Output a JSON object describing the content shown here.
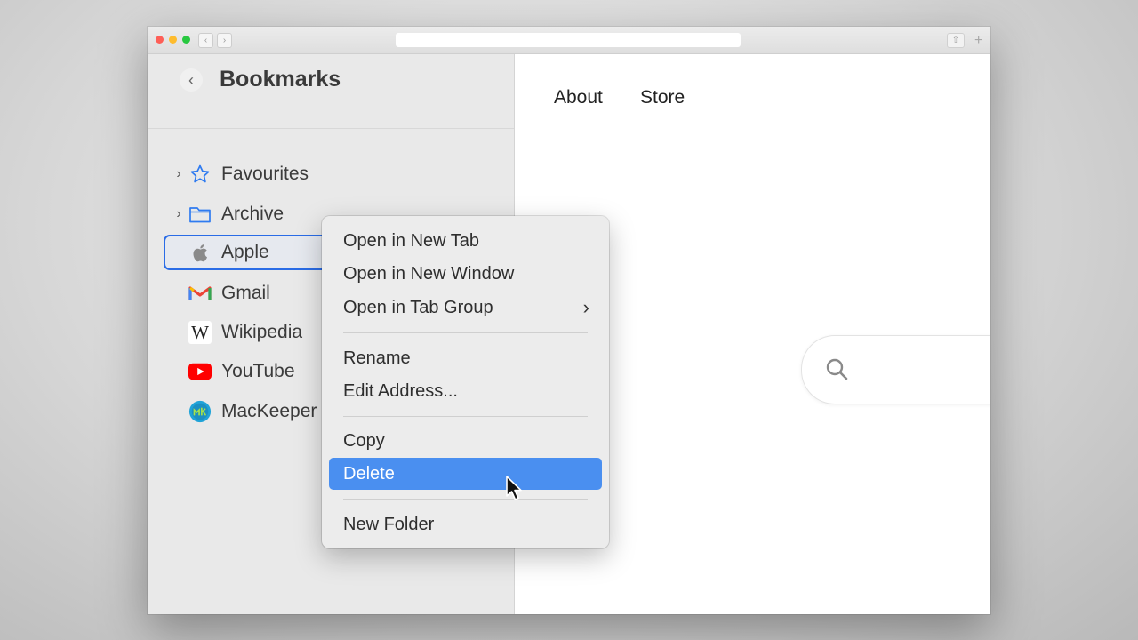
{
  "window": {
    "nav_back": "‹",
    "nav_forward": "›",
    "share_icon": "⇧",
    "new_tab_icon": "+"
  },
  "sidebar": {
    "back_label": "‹",
    "title": "Bookmarks",
    "items": [
      {
        "label": "Favourites",
        "icon": "star-icon",
        "folder": true
      },
      {
        "label": "Archive",
        "icon": "folder-icon",
        "folder": true
      },
      {
        "label": "Apple",
        "icon": "apple-icon",
        "selected": true
      },
      {
        "label": "Gmail",
        "icon": "gmail-icon"
      },
      {
        "label": "Wikipedia",
        "icon": "wikipedia-icon"
      },
      {
        "label": "YouTube",
        "icon": "youtube-icon"
      },
      {
        "label": "MacKeeper",
        "icon": "mackeeper-icon"
      }
    ]
  },
  "content": {
    "nav": [
      "About",
      "Store"
    ]
  },
  "context_menu": {
    "items": [
      {
        "label": "Open in New Tab"
      },
      {
        "label": "Open in New Window"
      },
      {
        "label": "Open in Tab Group",
        "submenu_arrow": "›"
      },
      {
        "label": "Rename"
      },
      {
        "label": "Edit Address..."
      },
      {
        "label": "Copy"
      },
      {
        "label": "Delete",
        "highlighted": true
      },
      {
        "label": "New Folder"
      }
    ]
  },
  "colors": {
    "accent": "#4a8ff0",
    "selection_border": "#2a6ce6",
    "sidebar_bg": "#e9e9e9"
  }
}
